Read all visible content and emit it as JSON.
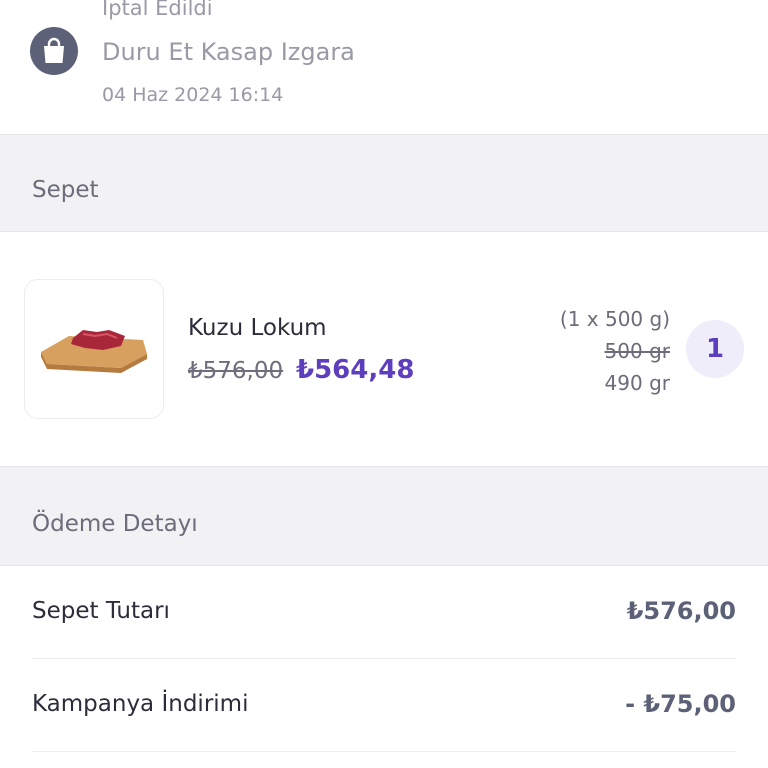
{
  "order": {
    "status": "İptal Edildi",
    "shop_name": "Duru Et Kasap Izgara",
    "date": "04 Haz 2024 16:14",
    "shop_icon": "shopping-bag-icon"
  },
  "basket": {
    "title": "Sepet",
    "items": [
      {
        "name": "Kuzu Lokum",
        "old_price": "₺576,00",
        "new_price": "₺564,48",
        "quantity_desc": "(1 x 500 g)",
        "weight_old": "500 gr",
        "weight_new": "490 gr",
        "quantity": "1",
        "image": "meat-on-board-image"
      }
    ]
  },
  "payment": {
    "title": "Ödeme Detayı",
    "rows": [
      {
        "label": "Sepet Tutarı",
        "value": "₺576,00"
      },
      {
        "label": "Kampanya İndirimi",
        "value": "- ₺75,00"
      }
    ]
  },
  "colors": {
    "accent": "#5d3ebc",
    "icon_bg": "#5c6178",
    "section_bg": "#f2f2f4"
  }
}
